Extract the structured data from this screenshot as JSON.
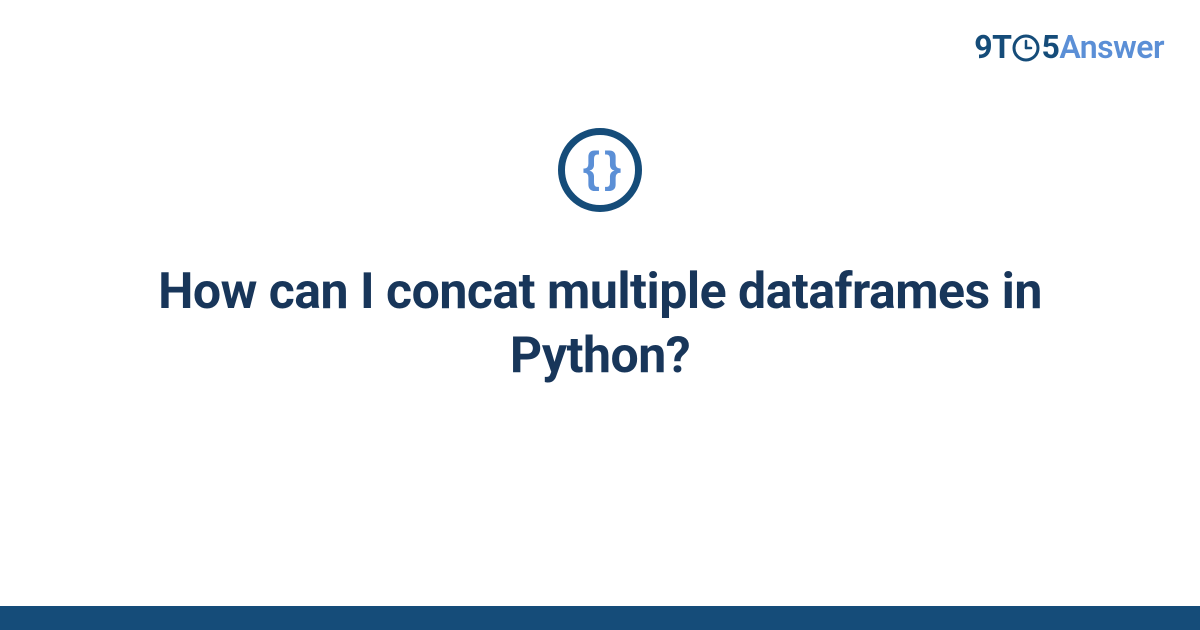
{
  "brand": {
    "part1": "9T",
    "part2": "5",
    "part3": "Answer"
  },
  "icon": {
    "symbol": "{ }"
  },
  "question": {
    "title": "How can I concat multiple dataframes in Python?"
  },
  "colors": {
    "dark_blue": "#154c79",
    "light_blue": "#5b8fd6",
    "title_color": "#18365a"
  }
}
